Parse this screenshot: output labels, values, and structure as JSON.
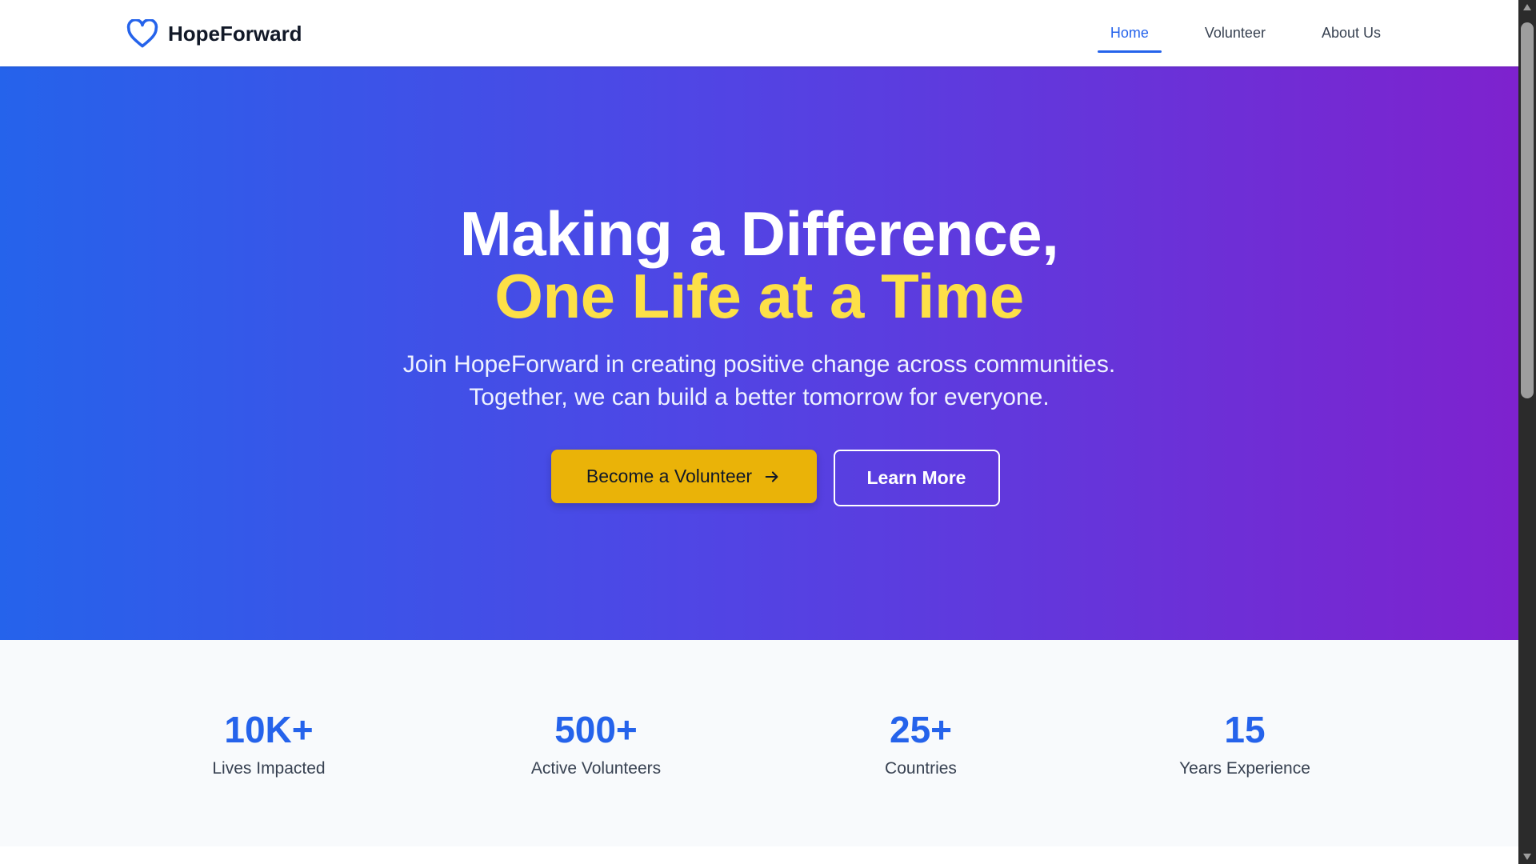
{
  "header": {
    "brand_name": "HopeForward",
    "brand_icon": "heart-icon",
    "nav": [
      {
        "label": "Home",
        "active": true
      },
      {
        "label": "Volunteer",
        "active": false
      },
      {
        "label": "About Us",
        "active": false
      }
    ]
  },
  "hero": {
    "title_line1": "Making a Difference,",
    "title_line2": "One Life at a Time",
    "subtitle_line1": "Join HopeForward in creating positive change across communities.",
    "subtitle_line2": "Together, we can build a better tomorrow for everyone.",
    "primary_button": "Become a Volunteer",
    "primary_button_icon": "arrow-right-icon",
    "secondary_button": "Learn More"
  },
  "stats": [
    {
      "value": "10K+",
      "label": "Lives Impacted"
    },
    {
      "value": "500+",
      "label": "Active Volunteers"
    },
    {
      "value": "25+",
      "label": "Countries"
    },
    {
      "value": "15",
      "label": "Years Experience"
    }
  ],
  "colors": {
    "accent": "#2563eb",
    "highlight": "#fde047",
    "primary_button": "#eab308",
    "hero_gradient_start": "#2563eb",
    "hero_gradient_end": "#7e22ce"
  }
}
